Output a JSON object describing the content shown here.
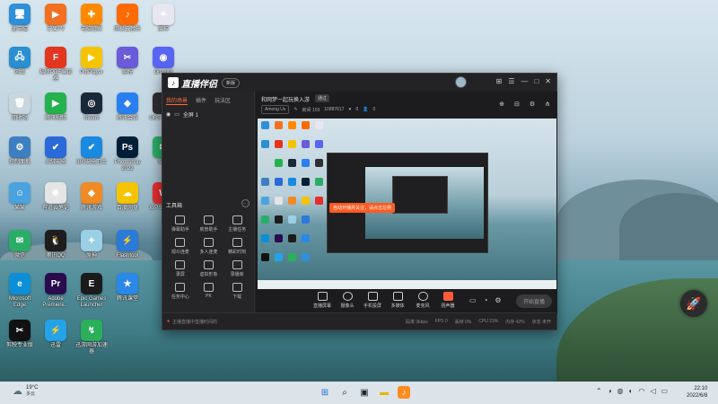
{
  "desktop": {
    "icons": [
      {
        "label": "此电脑",
        "glyph": "🖥",
        "color": "#2f8fd8"
      },
      {
        "label": "芒果TV",
        "glyph": "▶",
        "color": "#f37021"
      },
      {
        "label": "电脑管家",
        "glyph": "✚",
        "color": "#ff8a00"
      },
      {
        "label": "网易云音乐",
        "glyph": "♪",
        "color": "#ff6a00"
      },
      {
        "label": "原神",
        "glyph": "✦",
        "color": "#e8e6f0"
      },
      {
        "label": "网络",
        "glyph": "🖧",
        "color": "#2a8fd0"
      },
      {
        "label": "福昕PDF编辑器",
        "glyph": "F",
        "color": "#e4351f"
      },
      {
        "label": "PotPlayer",
        "glyph": "▶",
        "color": "#f5c400"
      },
      {
        "label": "剪映",
        "glyph": "✂",
        "color": "#6a5bd8"
      },
      {
        "label": "Discord",
        "glyph": "◉",
        "color": "#5865f2"
      },
      {
        "label": "回收站",
        "glyph": "🗑",
        "color": "#c9d6de"
      },
      {
        "label": "腾讯视频",
        "glyph": "▶",
        "color": "#24b24c"
      },
      {
        "label": "Steam",
        "glyph": "◎",
        "color": "#1b2838"
      },
      {
        "label": "腾讯会议",
        "glyph": "◆",
        "color": "#2a7ff0"
      },
      {
        "label": "OBS Studio",
        "glyph": "●",
        "color": "#302e31"
      },
      {
        "label": "控制面板",
        "glyph": "⚙",
        "color": "#3e7fc1"
      },
      {
        "label": "火绒安全",
        "glyph": "✔",
        "color": "#2a6ad8"
      },
      {
        "label": "360安全卫士",
        "glyph": "✔",
        "color": "#1a8ae0"
      },
      {
        "label": "Photoshop 2022",
        "glyph": "Ps",
        "color": "#001e36"
      },
      {
        "label": "微信",
        "glyph": "✉",
        "color": "#2aae67"
      },
      {
        "label": "某某",
        "glyph": "☺",
        "color": "#4aa3df"
      },
      {
        "label": "有道云笔记",
        "glyph": "❋",
        "color": "#e5e5e5"
      },
      {
        "label": "腾讯游戏",
        "glyph": "◆",
        "color": "#f08a24"
      },
      {
        "label": "百度网盘",
        "glyph": "☁",
        "color": "#f5c400"
      },
      {
        "label": "WPS Office",
        "glyph": "W",
        "color": "#e82d2d"
      },
      {
        "label": "微信",
        "glyph": "✉",
        "color": "#2aae67"
      },
      {
        "label": "腾讯QQ",
        "glyph": "🐧",
        "color": "#1d1d1d"
      },
      {
        "label": "原神",
        "glyph": "✦",
        "color": "#9ad0e6"
      },
      {
        "label": "Flashtool",
        "glyph": "⚡",
        "color": "#2a7ad8"
      },
      {
        "label": "Microsoft Edge",
        "glyph": "e",
        "color": "#0c8fd6"
      },
      {
        "label": "Adobe Premiere...",
        "glyph": "Pr",
        "color": "#2a0b4e"
      },
      {
        "label": "Epic Games Launcher",
        "glyph": "E",
        "color": "#1b1b1b"
      },
      {
        "label": "腾讯课堂",
        "glyph": "★",
        "color": "#2a88e8"
      },
      {
        "label": "剪映专业版",
        "glyph": "✂",
        "color": "#111111"
      },
      {
        "label": "迅雷",
        "glyph": "⚡",
        "color": "#25a3e8"
      },
      {
        "label": "迅游网游加速器",
        "glyph": "↯",
        "color": "#2ab05a"
      }
    ]
  },
  "app": {
    "name": "直播伴侣",
    "version_badge": "新版",
    "controls": [
      "⊞",
      "☰",
      "—",
      "□",
      "✕"
    ],
    "left_tabs": [
      "我的场景",
      "插件",
      "玩法区"
    ],
    "scene": {
      "name": "全屏 1"
    },
    "tools_title": "工具箱",
    "tools": [
      "弹幕助手",
      "房管助手",
      "主播任务",
      "观众连麦",
      "多人连麦",
      "精彩时刻",
      "录屏",
      "虚拟形象",
      "录播库",
      "任务中心",
      "PK",
      "下载"
    ],
    "room": {
      "title": "和网梦一起玩换入游",
      "tag": "通过",
      "game": "Among Us",
      "id": "房间 103",
      "fans": "10887617",
      "like_count": "0",
      "viewer_count": "0"
    },
    "right_icons": [
      "⊕",
      "⊟",
      "⚙",
      "⋔"
    ],
    "preview_tip": "自动开播并关注，请点击左侧",
    "bottom_buttons": [
      "直播屏幕",
      "摄像头",
      "手机投屏",
      "多媒体",
      "麦克风",
      "扬声器"
    ],
    "start_button": "开始直播",
    "status": {
      "notice": "主播直播中直播时间的",
      "stats": [
        "码率 0kbps",
        "FPS 0",
        "丢帧 0%",
        "CPU 23%",
        "内存 42%",
        "状态 未开"
      ]
    }
  },
  "taskbar": {
    "weather_temp": "19°C",
    "weather_desc": "多云",
    "time": "22:10",
    "date": "2022/6/8"
  }
}
